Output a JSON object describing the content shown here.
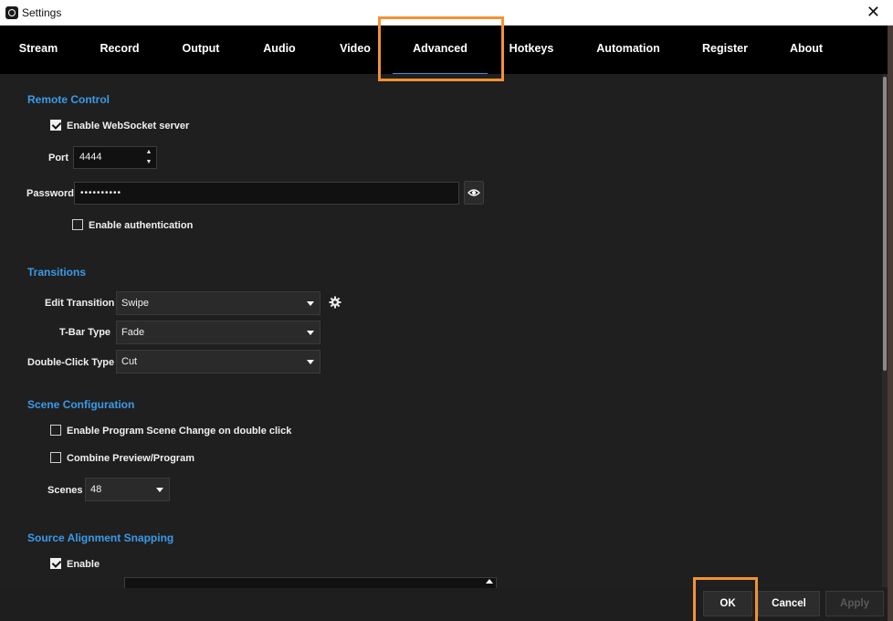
{
  "window": {
    "title": "Settings",
    "close_glyph": "✕"
  },
  "tabs": [
    {
      "label": "Stream"
    },
    {
      "label": "Record"
    },
    {
      "label": "Output"
    },
    {
      "label": "Audio"
    },
    {
      "label": "Video"
    },
    {
      "label": "Advanced",
      "active": true
    },
    {
      "label": "Hotkeys"
    },
    {
      "label": "Automation"
    },
    {
      "label": "Register"
    },
    {
      "label": "About"
    }
  ],
  "remote_control": {
    "title": "Remote Control",
    "enable_websocket_label": "Enable WebSocket server",
    "enable_websocket_checked": true,
    "port_label": "Port",
    "port_value": "4444",
    "password_label": "Password",
    "password_value": "••••••••••",
    "enable_auth_label": "Enable authentication",
    "enable_auth_checked": false
  },
  "transitions": {
    "title": "Transitions",
    "edit_transition_label": "Edit Transition",
    "edit_transition_value": "Swipe",
    "tbar_type_label": "T-Bar Type",
    "tbar_type_value": "Fade",
    "double_click_type_label": "Double-Click Type",
    "double_click_type_value": "Cut"
  },
  "scene_config": {
    "title": "Scene Configuration",
    "program_scene_change_label": "Enable Program Scene Change on double click",
    "program_scene_change_checked": false,
    "combine_preview_label": "Combine Preview/Program",
    "combine_preview_checked": false,
    "scenes_label": "Scenes",
    "scenes_value": "48"
  },
  "source_alignment": {
    "title": "Source Alignment Snapping",
    "enable_label": "Enable",
    "enable_checked": true
  },
  "footer": {
    "ok_label": "OK",
    "cancel_label": "Cancel",
    "apply_label": "Apply"
  },
  "colors": {
    "accent": "#3a9ae8",
    "highlight": "#f39233",
    "tab_bar_bg": "#000000",
    "content_bg": "#1f1f1f"
  },
  "icons": {
    "app": "app-logo-icon",
    "close": "close-icon",
    "eye": "eye-icon",
    "gear": "gear-icon"
  }
}
